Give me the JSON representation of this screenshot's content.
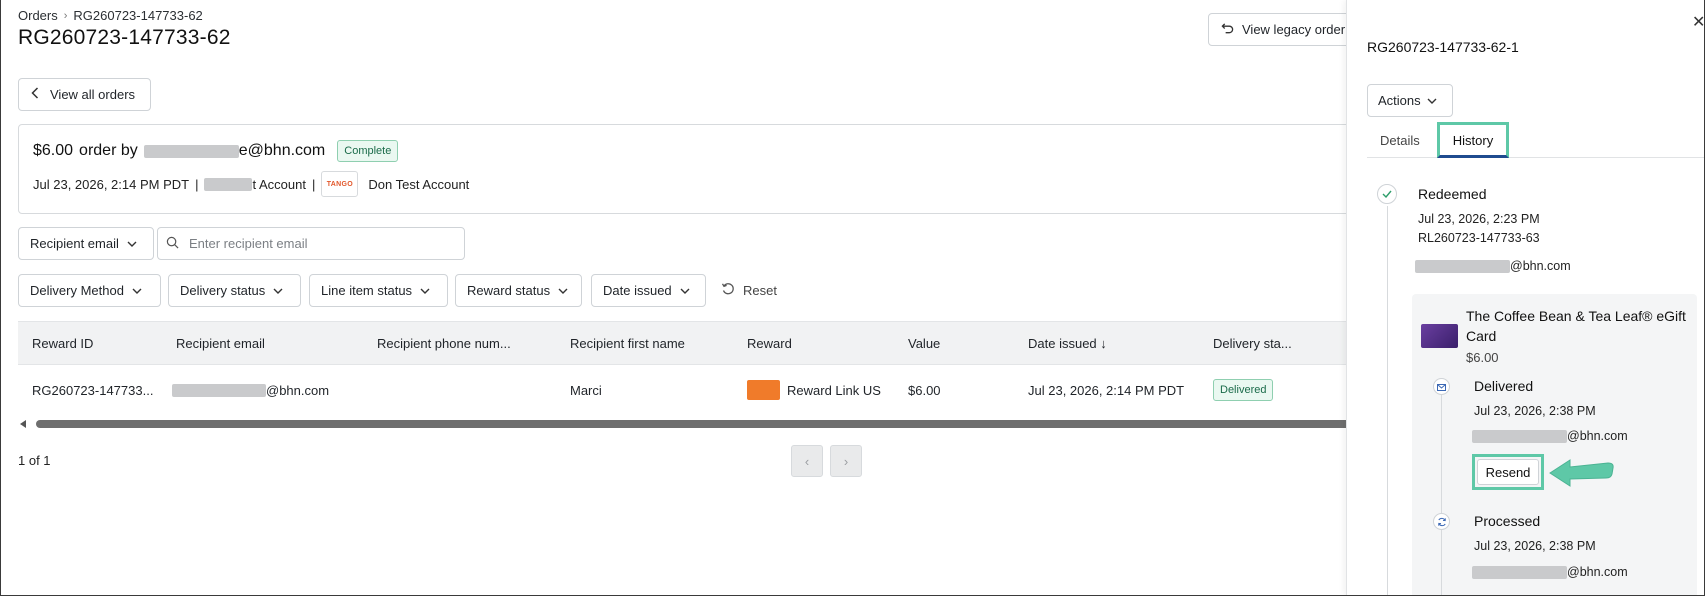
{
  "breadcrumb": {
    "parent": "Orders",
    "separator": "›",
    "current": "RG260723-147733-62"
  },
  "page_title": "RG260723-147733-62",
  "legacy_button": {
    "label": "View legacy order"
  },
  "view_all_button": {
    "label": "View all orders"
  },
  "order": {
    "amount": "$6.00",
    "order_by": "order by",
    "email_suffix": "e@bhn.com",
    "status": "Complete",
    "date": "Jul 23, 2026, 2:14 PM PDT",
    "pipe": "|",
    "account_suffix": "t Account",
    "brand_logo_text": "TANGO",
    "account_name": "Don Test Account"
  },
  "filters": {
    "recipient_email": "Recipient email",
    "search_placeholder": "Enter recipient email",
    "delivery_method": "Delivery Method",
    "delivery_status": "Delivery status",
    "line_item_status": "Line item status",
    "reward_status": "Reward status",
    "date_issued": "Date issued",
    "reset": "Reset"
  },
  "table": {
    "headers": [
      "Reward ID",
      "Recipient email",
      "Recipient phone num...",
      "Recipient first name",
      "Reward",
      "Value",
      "Date issued ↓",
      "Delivery sta..."
    ],
    "rows": [
      {
        "reward_id": "RG260723-147733...",
        "email_suffix": "@bhn.com",
        "phone": "",
        "first_name": "Marci",
        "reward": "Reward Link US",
        "value": "$6.00",
        "date_issued": "Jul 23, 2026, 2:14 PM PDT",
        "delivery_status": "Delivered"
      }
    ]
  },
  "pagination": {
    "count": "1 of 1",
    "prev": "‹",
    "next": "›"
  },
  "drawer": {
    "title": "RG260723-147733-62-1",
    "close": "✕",
    "actions_label": "Actions",
    "tabs": {
      "details": "Details",
      "history": "History"
    },
    "events": {
      "redeemed": {
        "title": "Redeemed",
        "date": "Jul 23, 2026, 2:23 PM",
        "ref": "RL260723-147733-63",
        "email_suffix": "@bhn.com"
      }
    },
    "card": {
      "name": "The Coffee Bean & Tea Leaf® eGift Card",
      "price": "$6.00",
      "delivered": {
        "title": "Delivered",
        "date": "Jul 23, 2026, 2:38 PM",
        "email_suffix": "@bhn.com"
      },
      "resend_label": "Resend",
      "processed": {
        "title": "Processed",
        "date": "Jul 23, 2026, 2:38 PM",
        "email_suffix": "@bhn.com"
      }
    }
  },
  "colors": {
    "highlight": "#5ec8a7",
    "tab_underline": "#1f4b8f",
    "reward_thumb": "#f07b2a",
    "badge_green": "#1b6b4a"
  }
}
